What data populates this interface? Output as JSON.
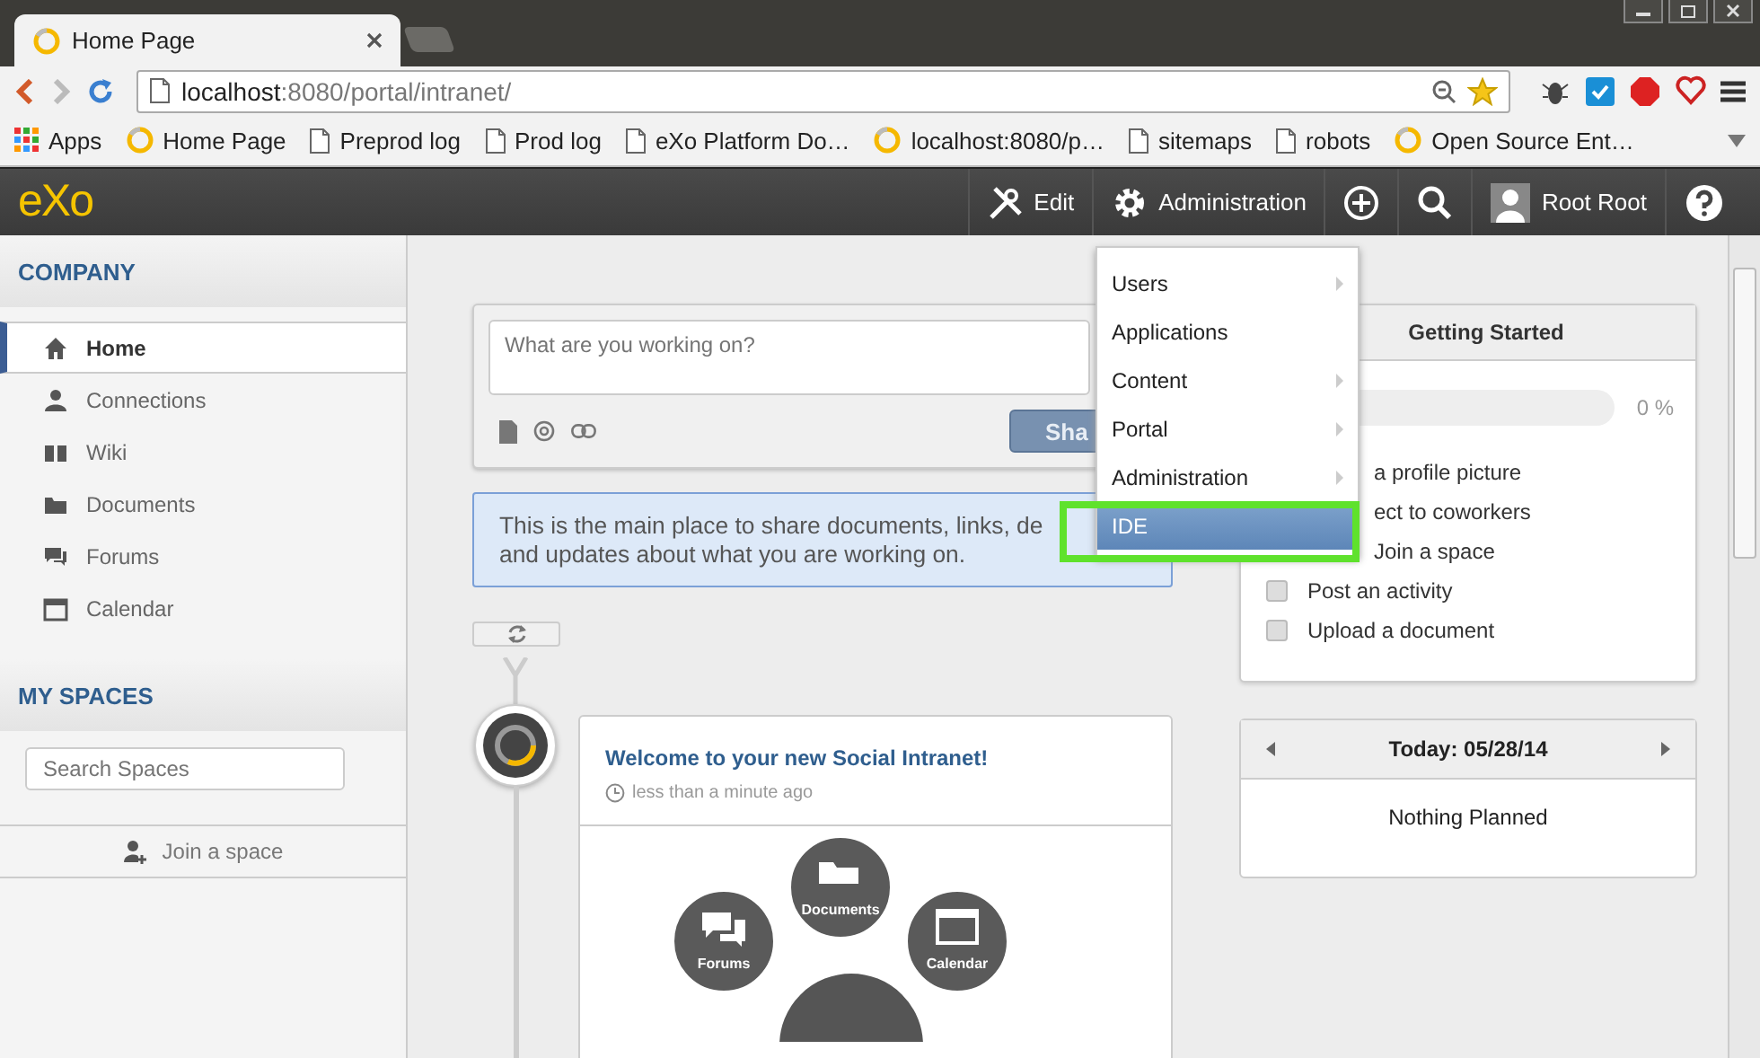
{
  "browser": {
    "tab_title": "Home Page",
    "url_host": "localhost",
    "url_rest": ":8080/portal/intranet/",
    "bookmarks": [
      {
        "label": "Apps",
        "kind": "apps"
      },
      {
        "label": "Home Page",
        "kind": "site"
      },
      {
        "label": "Preprod log",
        "kind": "page"
      },
      {
        "label": "Prod log",
        "kind": "page"
      },
      {
        "label": "eXo Platform Do…",
        "kind": "page"
      },
      {
        "label": "localhost:8080/p…",
        "kind": "site"
      },
      {
        "label": "sitemaps",
        "kind": "page"
      },
      {
        "label": "robots",
        "kind": "page"
      },
      {
        "label": "Open Source Ent…",
        "kind": "site"
      }
    ]
  },
  "topbar": {
    "logo": "eXo",
    "edit": "Edit",
    "administration": "Administration",
    "user": "Root Root"
  },
  "admin_menu": {
    "items": [
      {
        "label": "Users",
        "submenu": true,
        "selected": false
      },
      {
        "label": "Applications",
        "submenu": false,
        "selected": false
      },
      {
        "label": "Content",
        "submenu": true,
        "selected": false
      },
      {
        "label": "Portal",
        "submenu": true,
        "selected": false
      },
      {
        "label": "Administration",
        "submenu": true,
        "selected": false
      },
      {
        "label": "IDE",
        "submenu": false,
        "selected": true
      }
    ]
  },
  "sidebar": {
    "company_title": "COMPANY",
    "items": [
      {
        "label": "Home",
        "kind": "home",
        "selected": true
      },
      {
        "label": "Connections",
        "kind": "person",
        "selected": false
      },
      {
        "label": "Wiki",
        "kind": "book",
        "selected": false
      },
      {
        "label": "Documents",
        "kind": "folder",
        "selected": false
      },
      {
        "label": "Forums",
        "kind": "chat",
        "selected": false
      },
      {
        "label": "Calendar",
        "kind": "calendar",
        "selected": false
      }
    ],
    "spaces_title": "MY SPACES",
    "search": {
      "placeholder": "Search Spaces"
    },
    "join": "Join a space"
  },
  "composer": {
    "placeholder": "What are you working on?",
    "share_button": "Sha"
  },
  "info": {
    "lines": [
      "This is the main place to share documents, links, de",
      "and updates about what you are working on."
    ]
  },
  "activity": {
    "title": "Welcome to your new Social Intranet!",
    "time": "less than a minute ago",
    "bubbles": [
      {
        "label": "Forums",
        "kind": "forums"
      },
      {
        "label": "Documents",
        "kind": "documents"
      },
      {
        "label": "Calendar",
        "kind": "calendar"
      }
    ]
  },
  "getting_started": {
    "title": "Getting Started",
    "level": 0,
    "percent": "0 %",
    "items": [
      {
        "label": "a profile picture",
        "kind": "partial"
      },
      {
        "label": "ect to coworkers",
        "kind": "partial"
      },
      {
        "label": "Join a space",
        "kind": "partial"
      },
      {
        "label": "Post an activity",
        "kind": "task",
        "checked": false
      },
      {
        "label": "Upload a document",
        "kind": "task",
        "checked": false
      }
    ]
  },
  "calendar": {
    "title": "Today: 05/28/14",
    "empty": "Nothing Planned"
  }
}
